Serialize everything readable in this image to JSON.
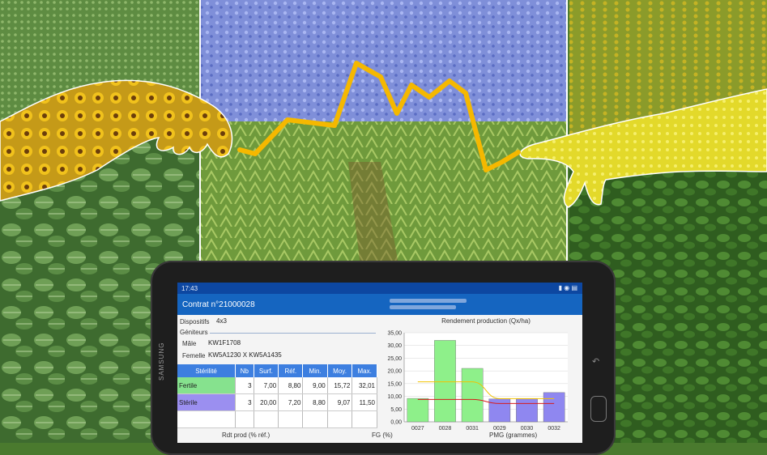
{
  "status": {
    "time": "17:43",
    "icons": "▮ ◉ ▤"
  },
  "app": {
    "title": "Contrat n°21000028"
  },
  "form": {
    "dispositifs_label": "Dispositifs",
    "dispositifs_value": "4x3",
    "geniteurs_label": "Géniteurs",
    "male_label": "Mâle",
    "male_value": "KW1F1708",
    "femelle_label": "Femelle",
    "femelle_value": "KW5A1230 X KW5A1435"
  },
  "table": {
    "headers": [
      "Stérilité",
      "Nb",
      "Surf.",
      "Réf.",
      "Min.",
      "Moy.",
      "Max."
    ],
    "rows": [
      [
        "Fertile",
        "3",
        "7,00",
        "8,80",
        "9,00",
        "15,72",
        "32,01"
      ],
      [
        "Stérile",
        "3",
        "20,00",
        "7,20",
        "8,80",
        "9,07",
        "11,50"
      ]
    ]
  },
  "bottom": {
    "rdt": "Rdt prod (% réf.)",
    "fg": "FG (%)",
    "pmg": "PMG (grammes)"
  },
  "chart_data": {
    "type": "bar",
    "title": "Rendement production (Qx/ha)",
    "categories": [
      "0027",
      "0028",
      "0031",
      "0029",
      "0030",
      "0032"
    ],
    "values": [
      9.2,
      32.0,
      21.0,
      9.0,
      9.0,
      11.5
    ],
    "bar_colors": [
      "#8ef08a",
      "#8ef08a",
      "#8ef08a",
      "#8f87f0",
      "#8f87f0",
      "#8f87f0"
    ],
    "ylim": [
      0,
      35
    ],
    "yticks": [
      "0,00",
      "5,00",
      "10,00",
      "15,00",
      "20,00",
      "25,00",
      "30,00",
      "35,00"
    ],
    "lines": [
      {
        "color": "#f2c200",
        "values": [
          15.7,
          15.7,
          15.7,
          9.1,
          9.1,
          9.1
        ]
      },
      {
        "color": "#d81b1b",
        "values": [
          8.8,
          8.8,
          8.8,
          7.2,
          7.2,
          7.2
        ]
      }
    ]
  },
  "colors": {
    "accent": "#1565c0",
    "statusbar": "#0d47a1",
    "table_header": "#3d7fe0",
    "fertile": "#86e28e",
    "sterile": "#9b8ff0",
    "photo_line": "#f5b800"
  },
  "device": {
    "brand": "SAMSUNG"
  }
}
